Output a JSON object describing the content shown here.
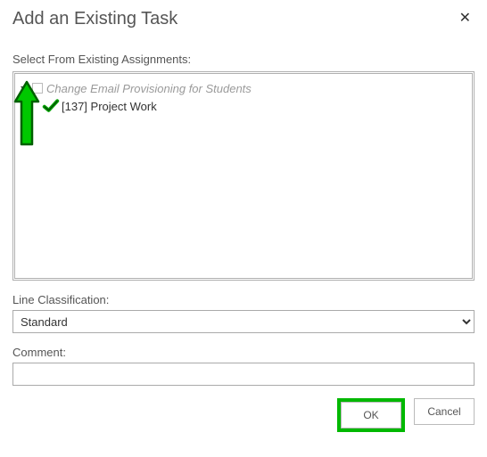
{
  "dialog": {
    "title": "Add an Existing Task",
    "close_label": "✕"
  },
  "assignments": {
    "label": "Select From Existing Assignments:",
    "parent_label": "Change Email Provisioning for Students",
    "child_label": "[137] Project Work"
  },
  "line_classification": {
    "label": "Line Classification:",
    "selected": "Standard"
  },
  "comment": {
    "label": "Comment:",
    "value": ""
  },
  "buttons": {
    "ok": "OK",
    "cancel": "Cancel"
  },
  "annotations": {
    "pointer_target": "expander",
    "highlight_target": "ok-button"
  }
}
